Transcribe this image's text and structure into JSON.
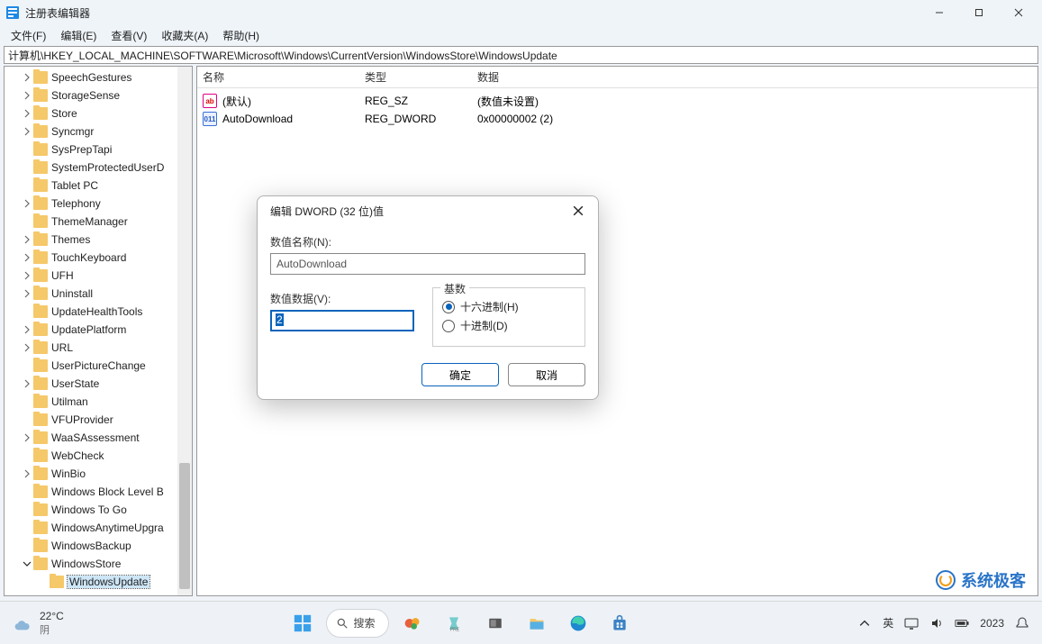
{
  "window": {
    "title": "注册表编辑器"
  },
  "menu": {
    "file": "文件(F)",
    "edit": "编辑(E)",
    "view": "查看(V)",
    "fav": "收藏夹(A)",
    "help": "帮助(H)"
  },
  "address": "计算机\\HKEY_LOCAL_MACHINE\\SOFTWARE\\Microsoft\\Windows\\CurrentVersion\\WindowsStore\\WindowsUpdate",
  "tree": [
    {
      "label": "SpeechGestures",
      "chev": "right",
      "depth": 1
    },
    {
      "label": "StorageSense",
      "chev": "right",
      "depth": 1
    },
    {
      "label": "Store",
      "chev": "right",
      "depth": 1
    },
    {
      "label": "Syncmgr",
      "chev": "right",
      "depth": 1
    },
    {
      "label": "SysPrepTapi",
      "chev": "none",
      "depth": 1
    },
    {
      "label": "SystemProtectedUserD",
      "chev": "none",
      "depth": 1
    },
    {
      "label": "Tablet PC",
      "chev": "none",
      "depth": 1
    },
    {
      "label": "Telephony",
      "chev": "right",
      "depth": 1
    },
    {
      "label": "ThemeManager",
      "chev": "none",
      "depth": 1
    },
    {
      "label": "Themes",
      "chev": "right",
      "depth": 1
    },
    {
      "label": "TouchKeyboard",
      "chev": "right",
      "depth": 1
    },
    {
      "label": "UFH",
      "chev": "right",
      "depth": 1
    },
    {
      "label": "Uninstall",
      "chev": "right",
      "depth": 1
    },
    {
      "label": "UpdateHealthTools",
      "chev": "none",
      "depth": 1
    },
    {
      "label": "UpdatePlatform",
      "chev": "right",
      "depth": 1
    },
    {
      "label": "URL",
      "chev": "right",
      "depth": 1
    },
    {
      "label": "UserPictureChange",
      "chev": "none",
      "depth": 1
    },
    {
      "label": "UserState",
      "chev": "right",
      "depth": 1
    },
    {
      "label": "Utilman",
      "chev": "none",
      "depth": 1
    },
    {
      "label": "VFUProvider",
      "chev": "none",
      "depth": 1
    },
    {
      "label": "WaaSAssessment",
      "chev": "right",
      "depth": 1
    },
    {
      "label": "WebCheck",
      "chev": "none",
      "depth": 1
    },
    {
      "label": "WinBio",
      "chev": "right",
      "depth": 1
    },
    {
      "label": "Windows Block Level B",
      "chev": "none",
      "depth": 1
    },
    {
      "label": "Windows To Go",
      "chev": "none",
      "depth": 1
    },
    {
      "label": "WindowsAnytimeUpgra",
      "chev": "none",
      "depth": 1
    },
    {
      "label": "WindowsBackup",
      "chev": "none",
      "depth": 1
    },
    {
      "label": "WindowsStore",
      "chev": "down",
      "depth": 1
    },
    {
      "label": "WindowsUpdate",
      "chev": "none",
      "depth": 2,
      "selected": true
    }
  ],
  "list": {
    "headers": {
      "name": "名称",
      "type": "类型",
      "data": "数据"
    },
    "rows": [
      {
        "icon": "sz",
        "name": "(默认)",
        "type": "REG_SZ",
        "data": "(数值未设置)"
      },
      {
        "icon": "dw",
        "name": "AutoDownload",
        "type": "REG_DWORD",
        "data": "0x00000002 (2)"
      }
    ]
  },
  "dialog": {
    "title": "编辑 DWORD (32 位)值",
    "name_label": "数值名称(N):",
    "name_value": "AutoDownload",
    "data_label": "数值数据(V):",
    "data_value": "2",
    "base_label": "基数",
    "hex_label": "十六进制(H)",
    "dec_label": "十进制(D)",
    "ok": "确定",
    "cancel": "取消"
  },
  "watermark": "系统极客",
  "taskbar": {
    "temp": "22°C",
    "weather": "阴",
    "search": "搜索",
    "ime": "英",
    "time": "2023"
  }
}
